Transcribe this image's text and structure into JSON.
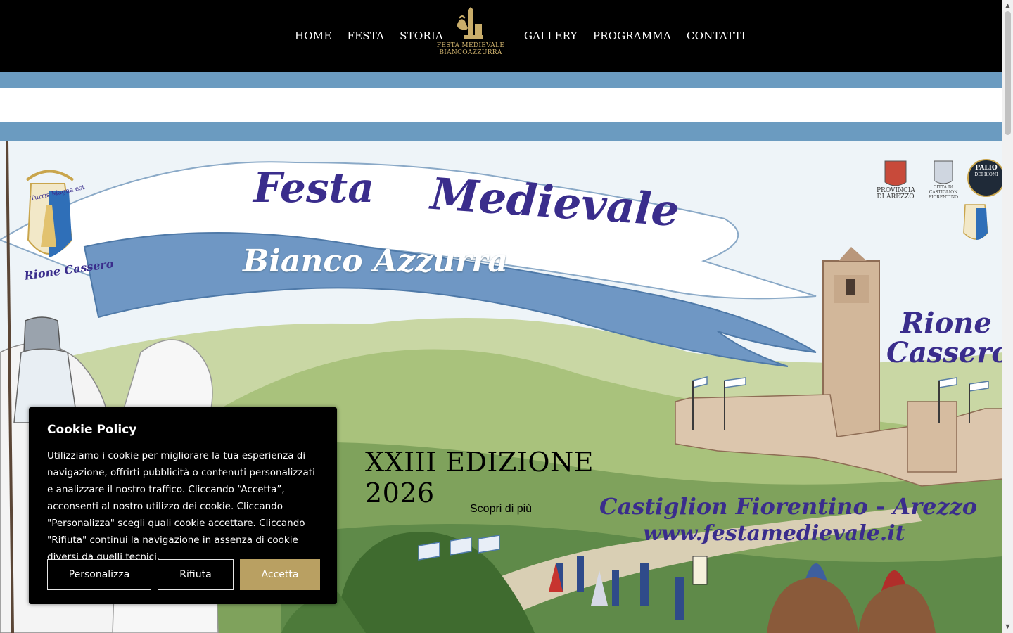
{
  "nav": {
    "left": [
      "HOME",
      "FESTA",
      "STORIA"
    ],
    "right": [
      "GALLERY",
      "PROGRAMMA",
      "CONTATTI"
    ],
    "logo_line1": "FESTA MEDIEVALE",
    "logo_line2": "BIANCOAZZURRA"
  },
  "hero": {
    "title_word1": "Festa",
    "title_word2": "Medievale",
    "subtitle": "Bianco Azzurra",
    "emblem_motto": "Turris Magna est",
    "emblem_label": "Rione Cassero",
    "rione_title_line1": "Rione",
    "rione_title_line2": "Cassero",
    "provincia_line1": "PROVINCIA",
    "provincia_line2": "DI AREZZO",
    "citta_line1": "CITTÀ DI",
    "citta_line2": "CASTIGLION FIORENTINO",
    "palio_label": "PALIO",
    "palio_sub": "DEI RIONI",
    "castiglion": "Castiglion Fiorentino - Arezzo",
    "website": "www.festamedievale.it",
    "edition": "XXIII EDIZIONE 2026",
    "more_link": "Scopri di più"
  },
  "cookie": {
    "title": "Cookie Policy",
    "text": "Utilizziamo i cookie per migliorare la tua esperienza di navigazione, offrirti pubblicità o contenuti personalizzati e analizzare il nostro traffico. Cliccando “Accetta”, acconsenti al nostro utilizzo dei cookie. Cliccando \"Personalizza\" scegli quali cookie accettare. Cliccando \"Rifiuta\" continui la navigazione in assenza di cookie diversi da quelli tecnici.",
    "btn_customize": "Personalizza",
    "btn_reject": "Rifiuta",
    "btn_accept": "Accetta"
  },
  "colors": {
    "header_bg": "#000000",
    "stripe": "#6b9bc0",
    "accent_gold": "#b9a062",
    "title_purple": "#3a2d8c"
  }
}
